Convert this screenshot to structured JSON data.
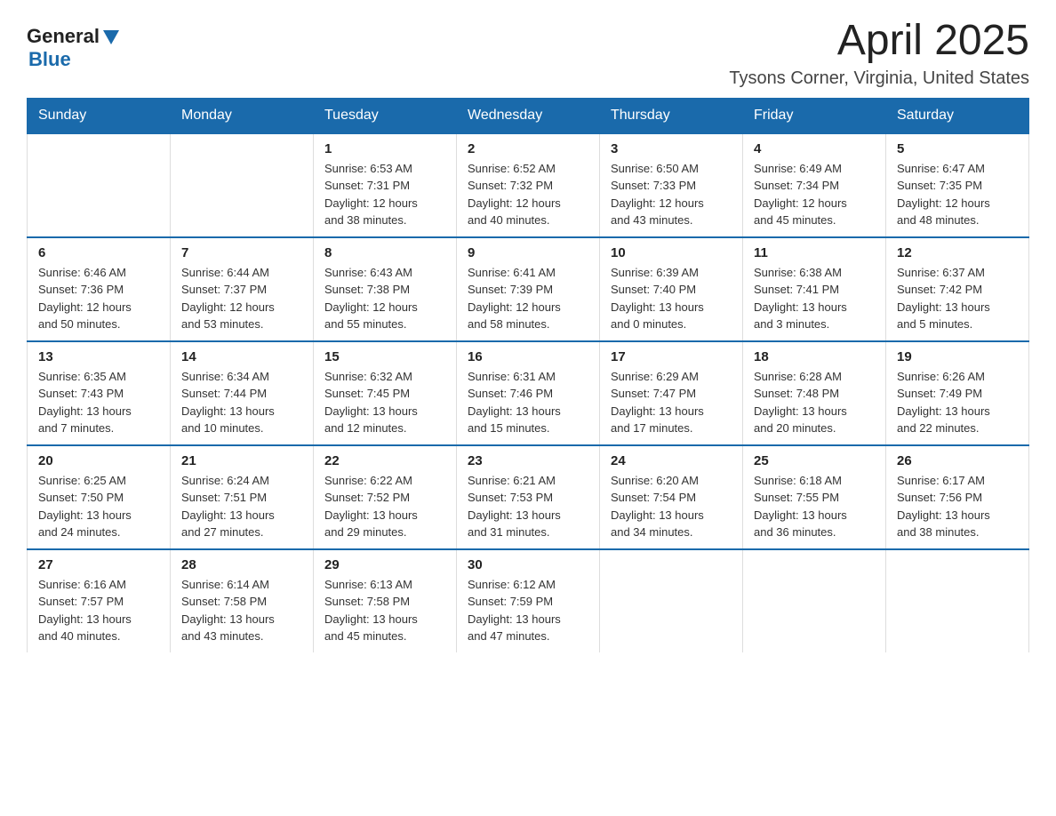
{
  "logo": {
    "general": "General",
    "blue": "Blue"
  },
  "header": {
    "title": "April 2025",
    "subtitle": "Tysons Corner, Virginia, United States"
  },
  "columns": [
    "Sunday",
    "Monday",
    "Tuesday",
    "Wednesday",
    "Thursday",
    "Friday",
    "Saturday"
  ],
  "weeks": [
    [
      {
        "day": "",
        "info": ""
      },
      {
        "day": "",
        "info": ""
      },
      {
        "day": "1",
        "info": "Sunrise: 6:53 AM\nSunset: 7:31 PM\nDaylight: 12 hours\nand 38 minutes."
      },
      {
        "day": "2",
        "info": "Sunrise: 6:52 AM\nSunset: 7:32 PM\nDaylight: 12 hours\nand 40 minutes."
      },
      {
        "day": "3",
        "info": "Sunrise: 6:50 AM\nSunset: 7:33 PM\nDaylight: 12 hours\nand 43 minutes."
      },
      {
        "day": "4",
        "info": "Sunrise: 6:49 AM\nSunset: 7:34 PM\nDaylight: 12 hours\nand 45 minutes."
      },
      {
        "day": "5",
        "info": "Sunrise: 6:47 AM\nSunset: 7:35 PM\nDaylight: 12 hours\nand 48 minutes."
      }
    ],
    [
      {
        "day": "6",
        "info": "Sunrise: 6:46 AM\nSunset: 7:36 PM\nDaylight: 12 hours\nand 50 minutes."
      },
      {
        "day": "7",
        "info": "Sunrise: 6:44 AM\nSunset: 7:37 PM\nDaylight: 12 hours\nand 53 minutes."
      },
      {
        "day": "8",
        "info": "Sunrise: 6:43 AM\nSunset: 7:38 PM\nDaylight: 12 hours\nand 55 minutes."
      },
      {
        "day": "9",
        "info": "Sunrise: 6:41 AM\nSunset: 7:39 PM\nDaylight: 12 hours\nand 58 minutes."
      },
      {
        "day": "10",
        "info": "Sunrise: 6:39 AM\nSunset: 7:40 PM\nDaylight: 13 hours\nand 0 minutes."
      },
      {
        "day": "11",
        "info": "Sunrise: 6:38 AM\nSunset: 7:41 PM\nDaylight: 13 hours\nand 3 minutes."
      },
      {
        "day": "12",
        "info": "Sunrise: 6:37 AM\nSunset: 7:42 PM\nDaylight: 13 hours\nand 5 minutes."
      }
    ],
    [
      {
        "day": "13",
        "info": "Sunrise: 6:35 AM\nSunset: 7:43 PM\nDaylight: 13 hours\nand 7 minutes."
      },
      {
        "day": "14",
        "info": "Sunrise: 6:34 AM\nSunset: 7:44 PM\nDaylight: 13 hours\nand 10 minutes."
      },
      {
        "day": "15",
        "info": "Sunrise: 6:32 AM\nSunset: 7:45 PM\nDaylight: 13 hours\nand 12 minutes."
      },
      {
        "day": "16",
        "info": "Sunrise: 6:31 AM\nSunset: 7:46 PM\nDaylight: 13 hours\nand 15 minutes."
      },
      {
        "day": "17",
        "info": "Sunrise: 6:29 AM\nSunset: 7:47 PM\nDaylight: 13 hours\nand 17 minutes."
      },
      {
        "day": "18",
        "info": "Sunrise: 6:28 AM\nSunset: 7:48 PM\nDaylight: 13 hours\nand 20 minutes."
      },
      {
        "day": "19",
        "info": "Sunrise: 6:26 AM\nSunset: 7:49 PM\nDaylight: 13 hours\nand 22 minutes."
      }
    ],
    [
      {
        "day": "20",
        "info": "Sunrise: 6:25 AM\nSunset: 7:50 PM\nDaylight: 13 hours\nand 24 minutes."
      },
      {
        "day": "21",
        "info": "Sunrise: 6:24 AM\nSunset: 7:51 PM\nDaylight: 13 hours\nand 27 minutes."
      },
      {
        "day": "22",
        "info": "Sunrise: 6:22 AM\nSunset: 7:52 PM\nDaylight: 13 hours\nand 29 minutes."
      },
      {
        "day": "23",
        "info": "Sunrise: 6:21 AM\nSunset: 7:53 PM\nDaylight: 13 hours\nand 31 minutes."
      },
      {
        "day": "24",
        "info": "Sunrise: 6:20 AM\nSunset: 7:54 PM\nDaylight: 13 hours\nand 34 minutes."
      },
      {
        "day": "25",
        "info": "Sunrise: 6:18 AM\nSunset: 7:55 PM\nDaylight: 13 hours\nand 36 minutes."
      },
      {
        "day": "26",
        "info": "Sunrise: 6:17 AM\nSunset: 7:56 PM\nDaylight: 13 hours\nand 38 minutes."
      }
    ],
    [
      {
        "day": "27",
        "info": "Sunrise: 6:16 AM\nSunset: 7:57 PM\nDaylight: 13 hours\nand 40 minutes."
      },
      {
        "day": "28",
        "info": "Sunrise: 6:14 AM\nSunset: 7:58 PM\nDaylight: 13 hours\nand 43 minutes."
      },
      {
        "day": "29",
        "info": "Sunrise: 6:13 AM\nSunset: 7:58 PM\nDaylight: 13 hours\nand 45 minutes."
      },
      {
        "day": "30",
        "info": "Sunrise: 6:12 AM\nSunset: 7:59 PM\nDaylight: 13 hours\nand 47 minutes."
      },
      {
        "day": "",
        "info": ""
      },
      {
        "day": "",
        "info": ""
      },
      {
        "day": "",
        "info": ""
      }
    ]
  ]
}
